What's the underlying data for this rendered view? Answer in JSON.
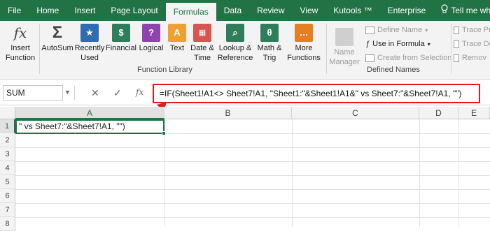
{
  "tabs": [
    "File",
    "Home",
    "Insert",
    "Page Layout",
    "Formulas",
    "Data",
    "Review",
    "View",
    "Kutools ™",
    "Enterprise"
  ],
  "tell_me": "Tell me what y",
  "ribbon": {
    "insert_function": "Insert\nFunction",
    "insert_function_icon": "fx",
    "autosum": "AutoSum",
    "recently_used": "Recently\nUsed",
    "financial": "Financial",
    "logical": "Logical",
    "text": "Text",
    "date_time": "Date &\nTime",
    "lookup_reference": "Lookup &\nReference",
    "math_trig": "Math &\nTrig",
    "more_functions": "More\nFunctions",
    "function_library_label": "Function Library",
    "name_manager": "Name\nManager",
    "define_name": "Define Name",
    "use_in_formula": "Use in Formula",
    "create_from_selection": "Create from Selection",
    "defined_names_label": "Defined Names",
    "trace_precedents": "Trace Pr",
    "trace_dependents": "Trace De",
    "remove_arrows": "Remov",
    "icon_colors": {
      "autosum": "#444444",
      "recently_used": "#2e6db4",
      "financial": "#2e7d5b",
      "logical": "#8e44ad",
      "text": "#f0a030",
      "date_time": "#d9534f",
      "lookup_reference": "#2e7d5b",
      "math_trig": "#2e7d5b",
      "more_functions": "#e67e22"
    }
  },
  "formula_bar": {
    "name_box": "SUM",
    "cancel_icon": "✕",
    "enter_icon": "✓",
    "fx_icon": "fx",
    "formula": "=IF(Sheet1!A1<> Sheet7!A1, \"Sheet1:\"&Sheet1!A1&\" vs Sheet7:\"&Sheet7!A1, \"\")"
  },
  "grid": {
    "columns": [
      "A",
      "B",
      "C",
      "D",
      "E"
    ],
    "rows": [
      "1",
      "2",
      "3",
      "4",
      "5",
      "6",
      "7",
      "8"
    ],
    "active_cell_text": "\" vs Sheet7:\"&Sheet7!A1, \"\")"
  },
  "colors": {
    "brand_green": "#217346",
    "highlight_red": "#e01b1b"
  }
}
